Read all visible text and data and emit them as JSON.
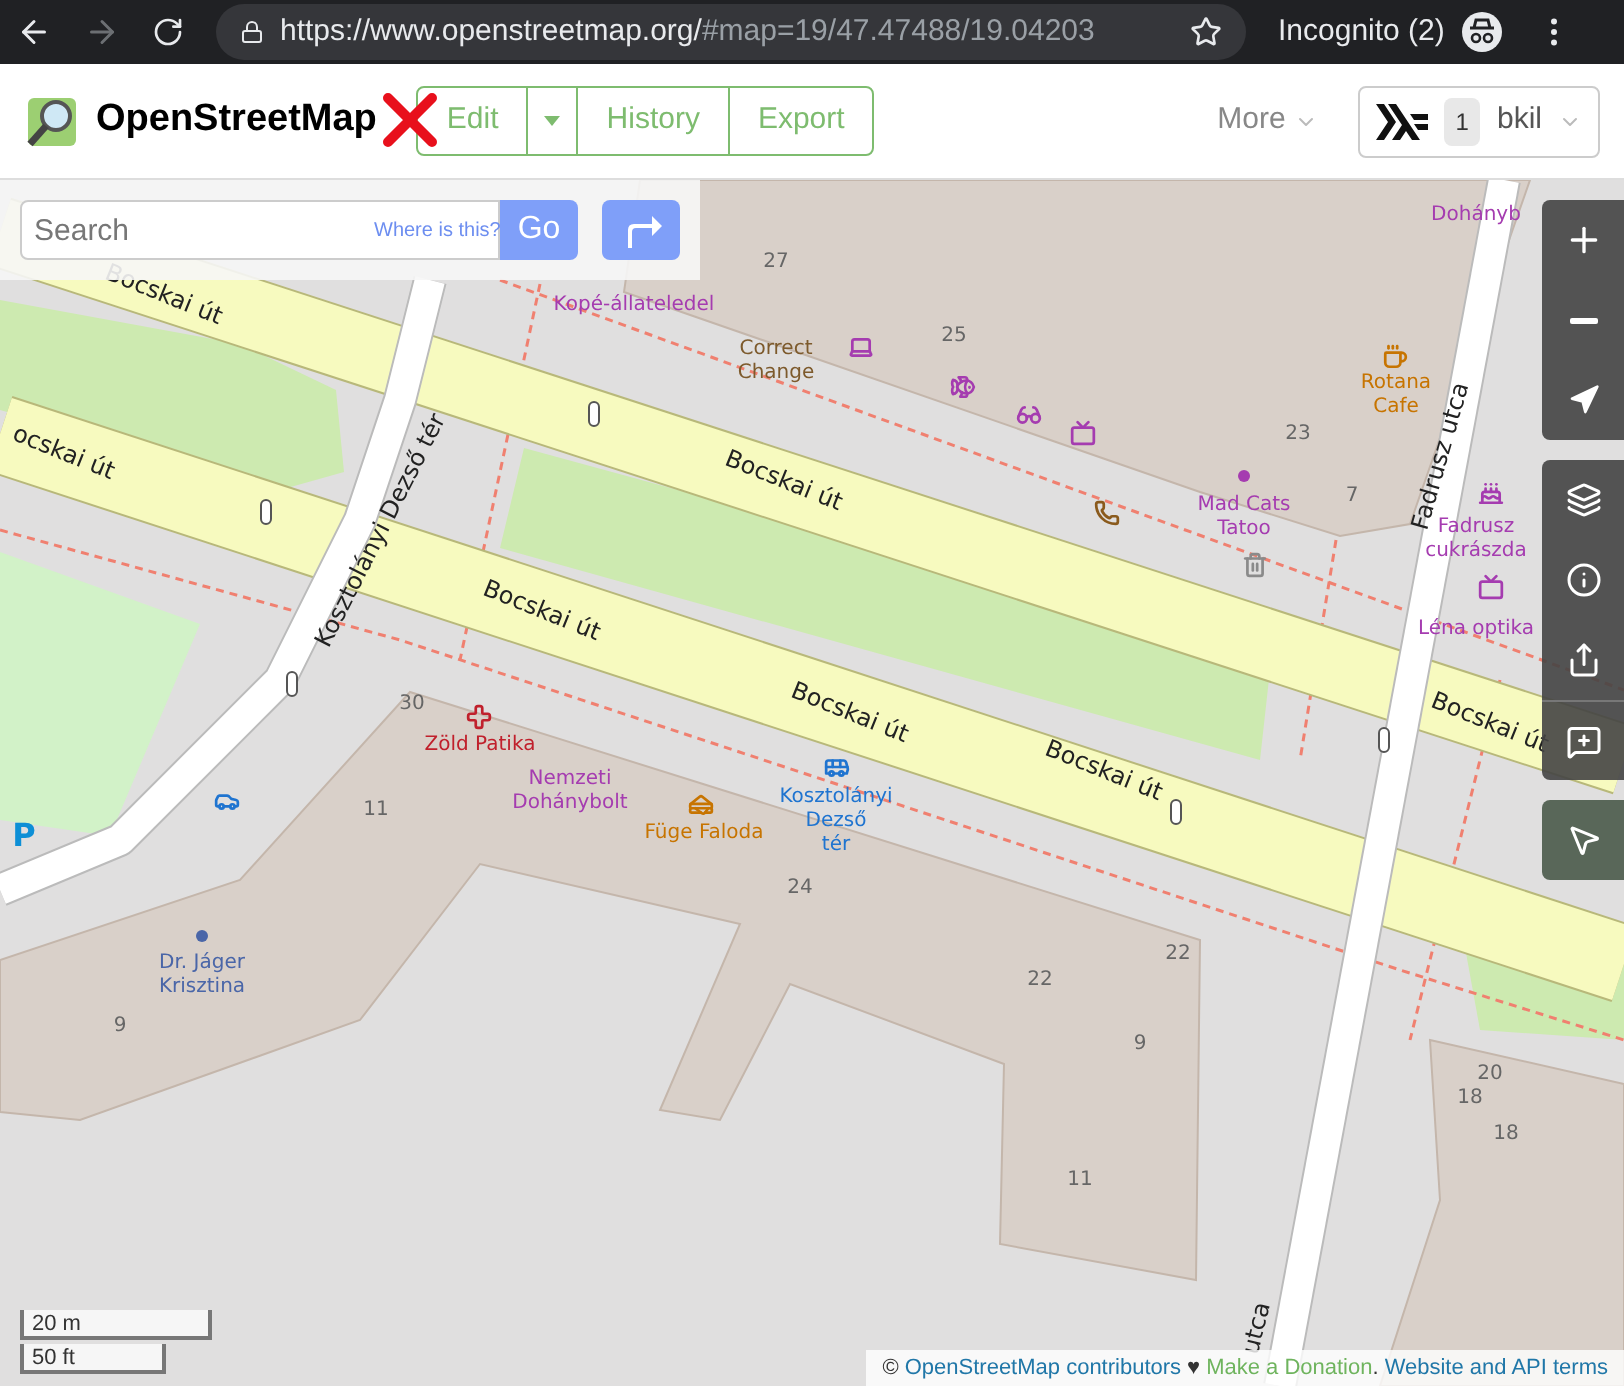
{
  "browser": {
    "url_host": "https://www.openstreetmap.org/",
    "url_rest": "#map=19/47.47488/19.04203",
    "profile": "Incognito (2)"
  },
  "header": {
    "logo": "OpenStreetMap",
    "tabs": [
      {
        "label": "Edit"
      },
      {
        "label": "History"
      },
      {
        "label": "Export"
      }
    ],
    "more": "More",
    "user": {
      "count": "1",
      "name": "bkil"
    }
  },
  "search": {
    "placeholder": "Search",
    "where_link": "Where is this?",
    "go": "Go"
  },
  "map": {
    "labels": [
      {
        "text": "Bocskai út",
        "kind": "street"
      },
      {
        "text": "Bocskai út",
        "kind": "street"
      },
      {
        "text": "ocskai út",
        "kind": "street"
      },
      {
        "text": "Bocskai út",
        "kind": "street"
      },
      {
        "text": "Bocskai út",
        "kind": "street"
      },
      {
        "text": "Bocskai út",
        "kind": "street"
      },
      {
        "text": "Bocskai út",
        "kind": "street"
      },
      {
        "text": "Kosztolányi Dezső tér",
        "kind": "street"
      },
      {
        "text": "Fadrusz utca",
        "kind": "street"
      },
      {
        "text": "utca",
        "kind": "street"
      },
      {
        "text": "Dohányb",
        "kind": "poi",
        "color": "#a53cb0"
      },
      {
        "text": "Kopé-állateledel",
        "kind": "poi",
        "color": "#a53cb0"
      },
      {
        "text": "Correct\nChange",
        "kind": "poi",
        "color": "#7d5a2c"
      },
      {
        "text": "Rotana\nCafe",
        "kind": "poi",
        "color": "#c77400"
      },
      {
        "text": "Mad Cats\nTatoo",
        "kind": "poi",
        "color": "#a53cb0"
      },
      {
        "text": "Fadrusz\ncukrászda",
        "kind": "poi",
        "color": "#a53cb0"
      },
      {
        "text": "Léna optika",
        "kind": "poi",
        "color": "#a53cb0"
      },
      {
        "text": "Zöld Patika",
        "kind": "poi",
        "color": "#c0202c"
      },
      {
        "text": "Nemzeti\nDohánybolt",
        "kind": "poi",
        "color": "#a53cb0"
      },
      {
        "text": "Füge Faloda",
        "kind": "poi",
        "color": "#c77400"
      },
      {
        "text": "Kosztolányi\nDezső\ntér",
        "kind": "poi",
        "color": "#1f74d0"
      },
      {
        "text": "Dr. Jáger\nKrisztina",
        "kind": "poi",
        "color": "#4a66a8"
      },
      {
        "text": "P",
        "kind": "poi",
        "color": "#0d8fd6"
      },
      {
        "text": "27",
        "kind": "housenumber"
      },
      {
        "text": "25",
        "kind": "housenumber"
      },
      {
        "text": "23",
        "kind": "housenumber"
      },
      {
        "text": "7",
        "kind": "housenumber"
      },
      {
        "text": "30",
        "kind": "housenumber"
      },
      {
        "text": "11",
        "kind": "housenumber"
      },
      {
        "text": "24",
        "kind": "housenumber"
      },
      {
        "text": "22",
        "kind": "housenumber"
      },
      {
        "text": "22",
        "kind": "housenumber"
      },
      {
        "text": "9",
        "kind": "housenumber"
      },
      {
        "text": "9",
        "kind": "housenumber"
      },
      {
        "text": "11",
        "kind": "housenumber"
      },
      {
        "text": "20",
        "kind": "housenumber"
      },
      {
        "text": "18",
        "kind": "housenumber"
      },
      {
        "text": "18",
        "kind": "housenumber"
      }
    ],
    "scale": [
      "20 m",
      "50 ft"
    ],
    "attribution": {
      "copyright": "©",
      "contributors": "OpenStreetMap contributors",
      "heart": "♥",
      "donate": "Make a Donation",
      "separator": ".",
      "terms": "Website and API terms"
    }
  }
}
